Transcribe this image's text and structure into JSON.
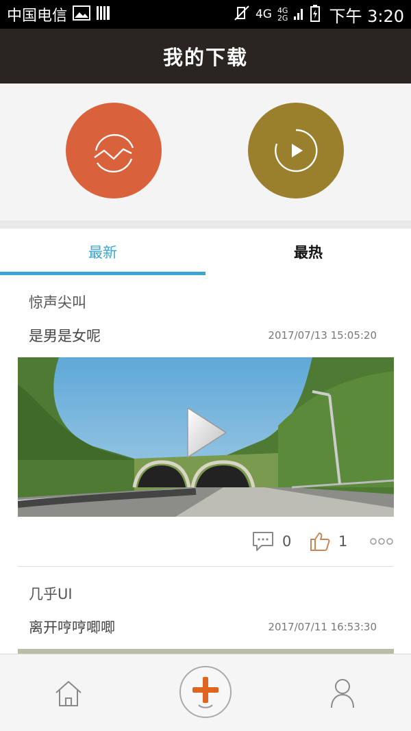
{
  "status_bar": {
    "carrier": "中国电信",
    "network_primary": "4G",
    "network_secondary_top": "4G",
    "network_secondary_bottom": "2G",
    "time": "下午 3:20",
    "icons": [
      "image-icon",
      "barcode-icon",
      "mute-icon",
      "signal-icon",
      "battery-icon"
    ]
  },
  "header": {
    "title": "我的下载"
  },
  "hero": {
    "buttons": [
      {
        "icon": "wave-circle-icon",
        "color": "#d9623c"
      },
      {
        "icon": "play-circle-icon",
        "color": "#9a7f2c"
      }
    ]
  },
  "tabs": [
    {
      "label": "最新",
      "active": true
    },
    {
      "label": "最热",
      "active": false
    }
  ],
  "posts": [
    {
      "category": "惊声尖叫",
      "title": "是男是女呢",
      "time": "2017/07/13 15:05:20",
      "comments": "0",
      "likes": "1"
    },
    {
      "category": "几乎UI",
      "title": "离开哼哼唧唧",
      "time": "2017/07/11 16:53:30"
    }
  ],
  "bottom_nav": {
    "items": [
      "home-icon",
      "add-icon",
      "profile-icon"
    ]
  },
  "colors": {
    "accent": "#3ba6d4",
    "header_bg": "#2a2521",
    "orange": "#d9623c",
    "olive": "#9a7f2c",
    "add_orange": "#e0661f"
  }
}
